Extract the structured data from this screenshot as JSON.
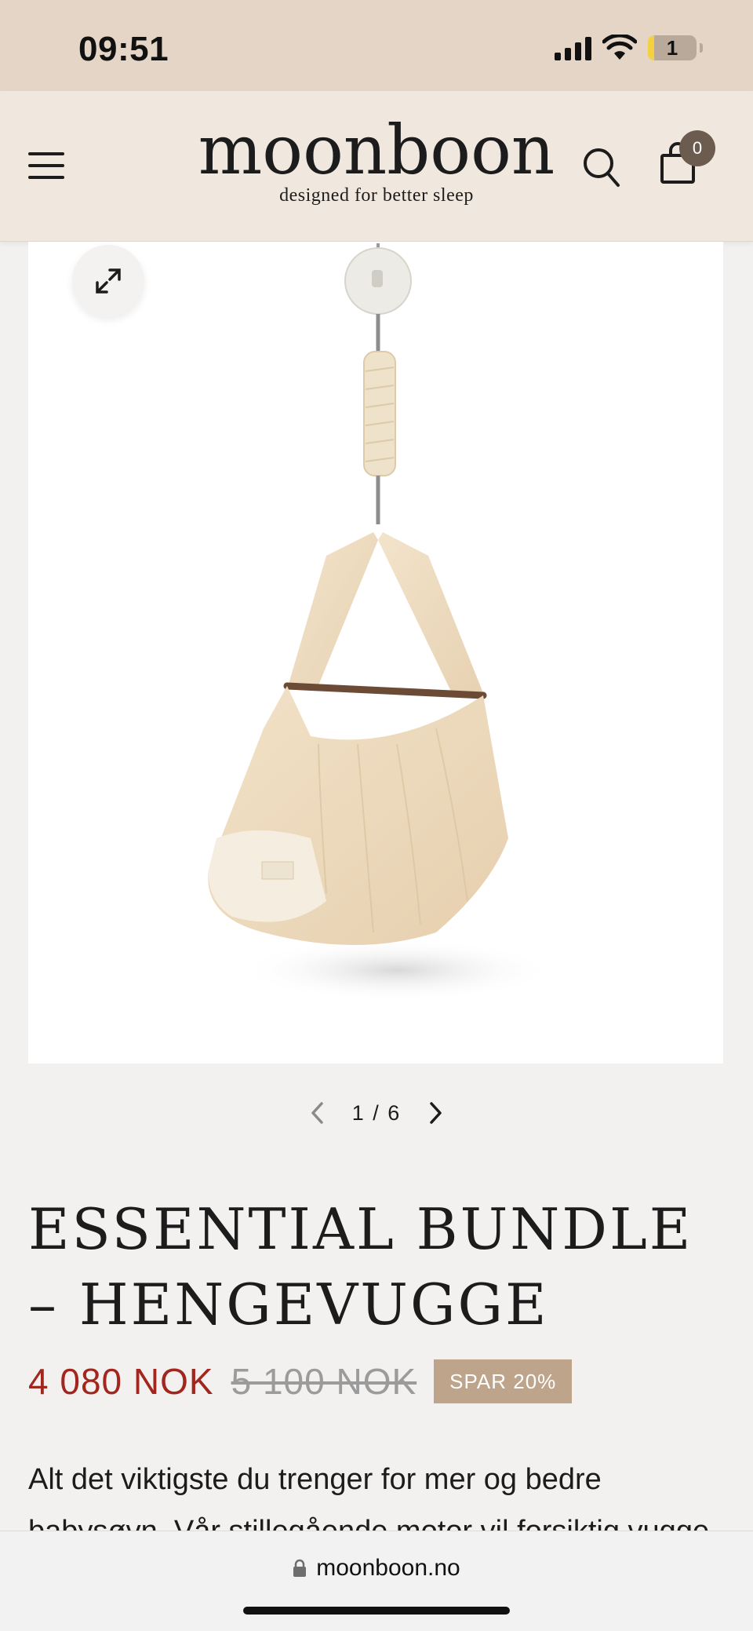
{
  "status_bar": {
    "time": "09:51",
    "battery": "1"
  },
  "header": {
    "logo": "moonboon",
    "tagline": "designed for better sleep",
    "cart_count": "0"
  },
  "gallery": {
    "current": "1",
    "separator": "/",
    "total": "6"
  },
  "product": {
    "title": "ESSENTIAL BUNDLE – HENGEVUGGE",
    "price": "4 080 NOK",
    "original_price": "5 100 NOK",
    "discount": "SPAR 20%",
    "description": "Alt det viktigste du trenger for mer og bedre babysøvn. Vår stillegående motor vil forsiktig vugge"
  },
  "browser": {
    "url": "moonboon.no"
  },
  "colors": {
    "sale": "#a1261e",
    "badge": "#bda48b",
    "header": "#f0e7de",
    "status": "#e5d5c6"
  }
}
